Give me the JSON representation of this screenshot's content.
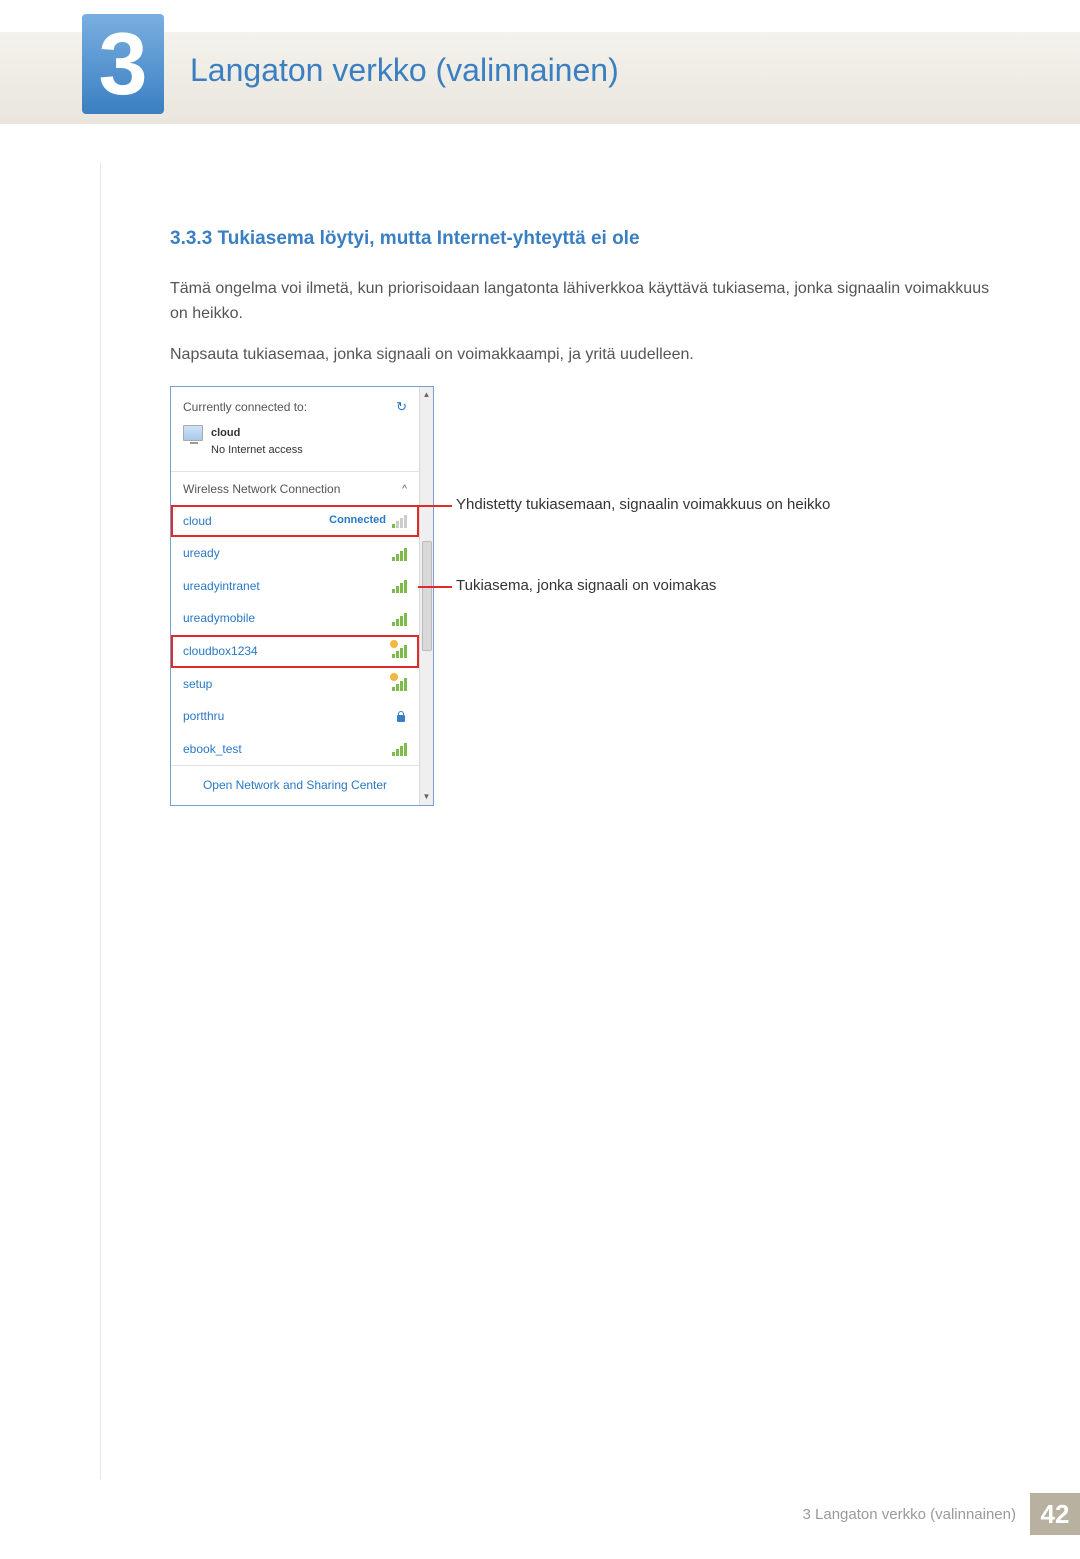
{
  "chapter": {
    "number": "3",
    "title": "Langaton verkko (valinnainen)"
  },
  "section": {
    "numbered_title": "3.3.3  Tukiasema löytyi, mutta Internet-yhteyttä ei ole"
  },
  "paragraphs": {
    "p1": "Tämä ongelma voi ilmetä, kun priorisoidaan langatonta lähiverkkoa käyttävä tukiasema, jonka signaalin voimakkuus on heikko.",
    "p2": "Napsauta tukiasemaa, jonka signaali on voimakkaampi, ja yritä uudelleen."
  },
  "network_panel": {
    "top_label": "Currently connected to:",
    "refresh_glyph": "↻",
    "current": {
      "name": "cloud",
      "status": "No Internet access"
    },
    "section_label": "Wireless Network Connection",
    "chevron_glyph": "^",
    "items": [
      {
        "name": "cloud",
        "status": "Connected",
        "signal": "weak",
        "highlight": true
      },
      {
        "name": "uready",
        "signal": "full"
      },
      {
        "name": "ureadyintranet",
        "signal": "full"
      },
      {
        "name": "ureadymobile",
        "signal": "full"
      },
      {
        "name": "cloudbox1234",
        "signal": "sun",
        "highlight": true
      },
      {
        "name": "setup",
        "signal": "sun"
      },
      {
        "name": "portthru",
        "signal": "lock"
      },
      {
        "name": "ebook_test",
        "signal": "full"
      }
    ],
    "footer_link": "Open Network and Sharing Center",
    "scroll": {
      "up": "▲",
      "down": "▼"
    }
  },
  "callouts": {
    "c1": "Yhdistetty tukiasemaan, signaalin voimakkuus on heikko",
    "c2": "Tukiasema, jonka signaali on voimakas"
  },
  "footer": {
    "label": "3 Langaton verkko (valinnainen)",
    "page": "42"
  }
}
